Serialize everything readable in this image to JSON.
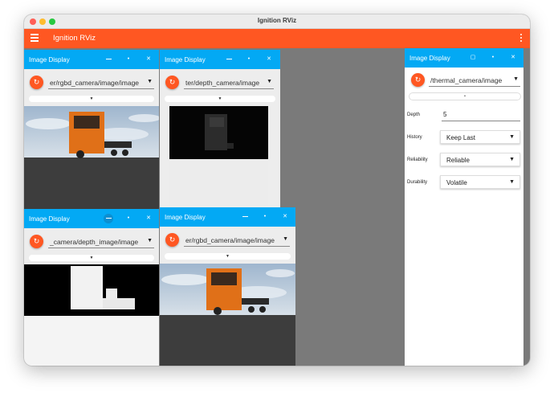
{
  "window": {
    "title": "Ignition RViz"
  },
  "appbar": {
    "title": "Ignition RViz"
  },
  "panels": [
    {
      "title": "Image Display",
      "topic": "er/rgbd_camera/image/image"
    },
    {
      "title": "Image Display",
      "topic": "ter/depth_camera/image"
    },
    {
      "title": "Image Display",
      "topic": "_camera/depth_image/image"
    },
    {
      "title": "Image Display",
      "topic": "er/rgbd_camera/image/image"
    }
  ],
  "side": {
    "title": "Image Display",
    "topic": "/thermal_camera/image",
    "depth_label": "Depth",
    "depth_value": "5",
    "history_label": "History",
    "history_value": "Keep Last",
    "reliability_label": "Reliability",
    "reliability_value": "Reliable",
    "durability_label": "Durability",
    "durability_value": "Volatile"
  },
  "colors": {
    "accent": "#ff5722",
    "panel_header": "#03a9f4",
    "workspace": "#7a7a7a"
  },
  "icons": {
    "refresh": "refresh-icon",
    "menu": "hamburger-menu-icon",
    "more": "more-vert-icon",
    "close": "close-icon",
    "minimize": "minimize-icon",
    "maximize": "maximize-icon",
    "dropdown": "arrow-drop-down-icon"
  }
}
